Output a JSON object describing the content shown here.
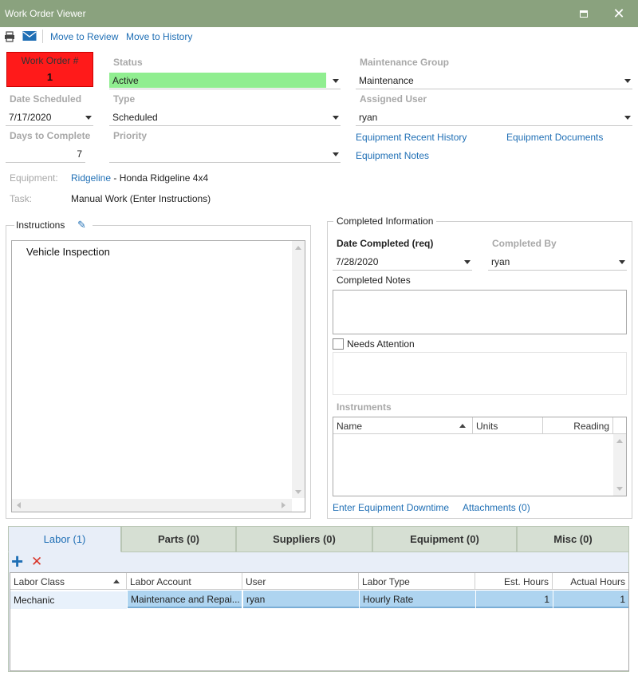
{
  "window": {
    "title": "Work Order Viewer"
  },
  "toolbar": {
    "move_review": "Move to Review",
    "move_history": "Move to History"
  },
  "header": {
    "wo_label": "Work Order #",
    "wo_number": "1",
    "wo_color": "#ff1a1a",
    "status_label": "Status",
    "status_value": "Active",
    "status_color": "#90ee90",
    "maint_group_label": "Maintenance Group",
    "maint_group_value": "Maintenance",
    "date_scheduled_label": "Date Scheduled",
    "date_scheduled_value": "7/17/2020",
    "type_label": "Type",
    "type_value": "Scheduled",
    "assigned_user_label": "Assigned User",
    "assigned_user_value": "ryan",
    "days_label": "Days to Complete",
    "days_value": "7",
    "priority_label": "Priority",
    "priority_value": "",
    "equip_recent_history": "Equipment Recent History",
    "equip_documents": "Equipment Documents",
    "equip_notes": "Equipment Notes"
  },
  "equipment": {
    "label": "Equipment:",
    "link": "Ridgeline",
    "desc": " - Honda Ridgeline 4x4"
  },
  "task": {
    "label": "Task:",
    "value": "Manual Work (Enter Instructions)"
  },
  "instructions": {
    "title": "Instructions",
    "text": "Vehicle Inspection"
  },
  "completed": {
    "title": "Completed Information",
    "date_label": "Date Completed (req)",
    "date_value": "7/28/2020",
    "by_label": "Completed By",
    "by_value": "ryan",
    "notes_label": "Completed Notes",
    "needs_attention": "Needs Attention",
    "instruments_label": "Instruments",
    "inst_cols": [
      "Name",
      "Units",
      "Reading"
    ],
    "downtime_link": "Enter Equipment Downtime",
    "attachments_link": "Attachments (0)"
  },
  "tabs": [
    "Labor  (1)",
    "Parts  (0)",
    "Suppliers  (0)",
    "Equipment  (0)",
    "Misc  (0)"
  ],
  "labor": {
    "columns": [
      "Labor Class",
      "Labor Account",
      "User",
      "Labor Type",
      "Est. Hours",
      "Actual Hours"
    ],
    "row": [
      "Mechanic",
      "Maintenance and Repai...",
      "ryan",
      "Hourly Rate",
      "1",
      "1"
    ]
  }
}
